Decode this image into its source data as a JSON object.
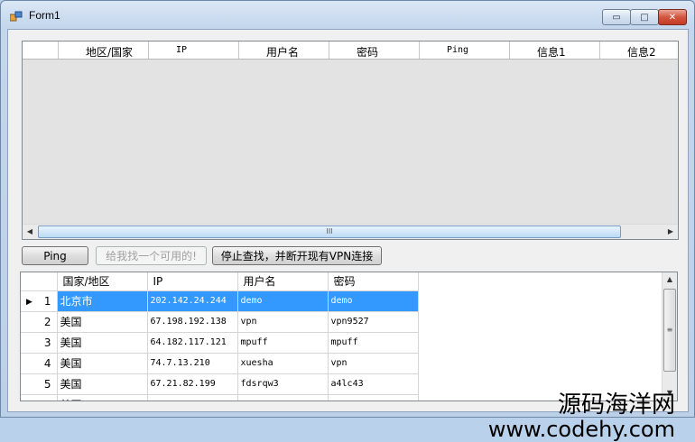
{
  "window": {
    "title": "Form1",
    "min_glyph": "▭",
    "max_glyph": "□",
    "close_glyph": "✕"
  },
  "top_grid": {
    "columns": [
      "地区/国家",
      "IP",
      "用户名",
      "密码",
      "Ping",
      "信息1",
      "信息2"
    ],
    "scroll_left": "◀",
    "scroll_right": "▶",
    "thumb_grip": "III"
  },
  "buttons": {
    "ping": "Ping",
    "find": "给我找一个可用的!",
    "stop": "停止查找，并断开现有VPN连接"
  },
  "bottom_grid": {
    "columns": [
      "国家/地区",
      "IP",
      "用户名",
      "密码"
    ],
    "current_row_marker": "▶",
    "rows": [
      {
        "num": "1",
        "country": "北京市",
        "ip": "202.142.24.244",
        "user": "demo",
        "pass": "demo"
      },
      {
        "num": "2",
        "country": "美国",
        "ip": "67.198.192.138",
        "user": "vpn",
        "pass": "vpn9527"
      },
      {
        "num": "3",
        "country": "美国",
        "ip": "64.182.117.121",
        "user": "mpuff",
        "pass": "mpuff"
      },
      {
        "num": "4",
        "country": "美国",
        "ip": "74.7.13.210",
        "user": "xuesha",
        "pass": "vpn"
      },
      {
        "num": "5",
        "country": "美国",
        "ip": "67.21.82.199",
        "user": "fdsrqw3",
        "pass": "a4lc43"
      }
    ],
    "partial_row_country": "美国",
    "scroll_up": "▲",
    "scroll_down": "▼",
    "thumb_grip": "≡"
  },
  "watermark": {
    "line1": "源码海洋网",
    "line2": "www.codehy.com"
  }
}
